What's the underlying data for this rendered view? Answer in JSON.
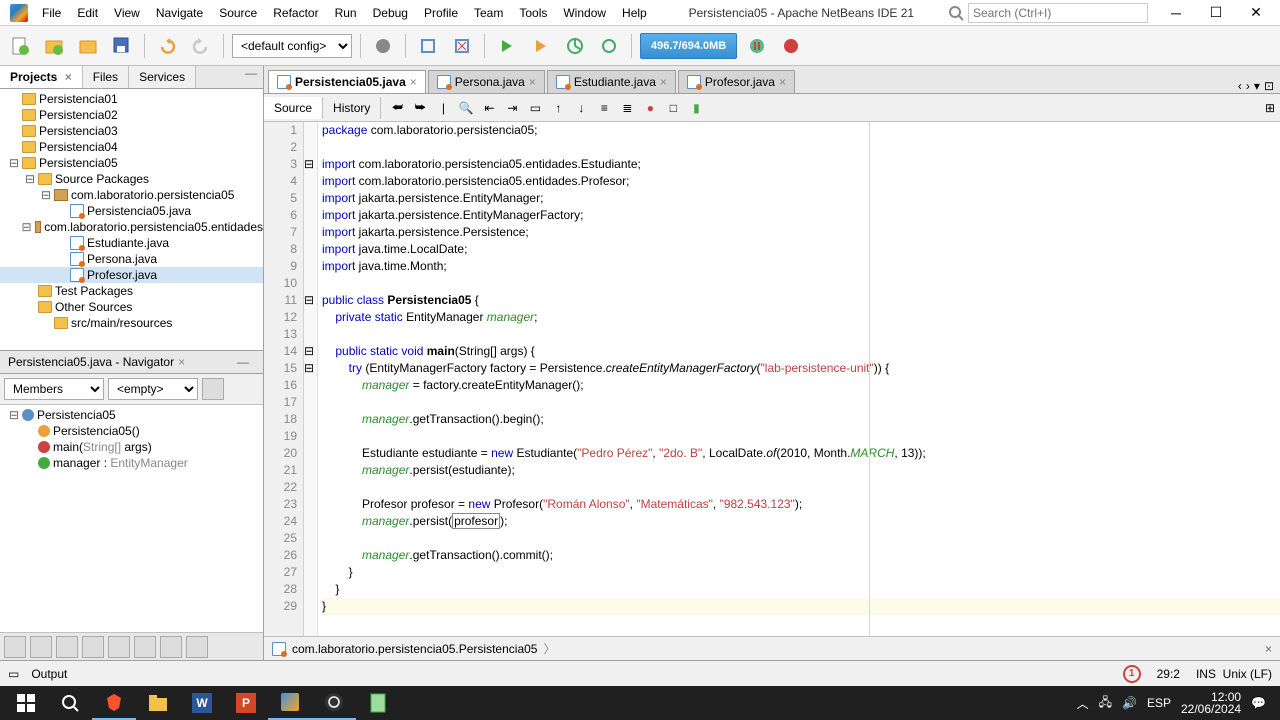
{
  "window": {
    "title": "Persistencia05 - Apache NetBeans IDE 21",
    "search_placeholder": "Search (Ctrl+I)"
  },
  "menu": [
    "File",
    "Edit",
    "View",
    "Navigate",
    "Source",
    "Refactor",
    "Run",
    "Debug",
    "Profile",
    "Team",
    "Tools",
    "Window",
    "Help"
  ],
  "toolbar": {
    "config": "<default config>",
    "memory": "496.7/694.0MB"
  },
  "projects_panel": {
    "tabs": [
      "Projects",
      "Files",
      "Services"
    ],
    "active_tab": "Projects",
    "tree": [
      {
        "level": 0,
        "icon": "folder",
        "label": "Persistencia01"
      },
      {
        "level": 0,
        "icon": "folder",
        "label": "Persistencia02"
      },
      {
        "level": 0,
        "icon": "folder",
        "label": "Persistencia03"
      },
      {
        "level": 0,
        "icon": "folder",
        "label": "Persistencia04"
      },
      {
        "level": 0,
        "icon": "folder",
        "label": "Persistencia05",
        "expanded": true
      },
      {
        "level": 1,
        "icon": "folder",
        "label": "Source Packages",
        "expanded": true
      },
      {
        "level": 2,
        "icon": "pkg",
        "label": "com.laboratorio.persistencia05",
        "expanded": true
      },
      {
        "level": 3,
        "icon": "java",
        "label": "Persistencia05.java"
      },
      {
        "level": 2,
        "icon": "pkg",
        "label": "com.laboratorio.persistencia05.entidades",
        "expanded": true
      },
      {
        "level": 3,
        "icon": "java",
        "label": "Estudiante.java"
      },
      {
        "level": 3,
        "icon": "java",
        "label": "Persona.java"
      },
      {
        "level": 3,
        "icon": "java",
        "label": "Profesor.java",
        "selected": true
      },
      {
        "level": 1,
        "icon": "folder",
        "label": "Test Packages"
      },
      {
        "level": 1,
        "icon": "folder",
        "label": "Other Sources"
      },
      {
        "level": 2,
        "icon": "folder",
        "label": "src/main/resources"
      }
    ]
  },
  "navigator": {
    "title": "Persistencia05.java - Navigator",
    "members_label": "Members",
    "empty_label": "<empty>",
    "tree": [
      {
        "level": 0,
        "icon": "class",
        "label": "Persistencia05"
      },
      {
        "level": 1,
        "icon": "ctor",
        "label": "Persistencia05()"
      },
      {
        "level": 1,
        "icon": "method",
        "label_html": "main(<span style='color:#888'>String[]</span> args)"
      },
      {
        "level": 1,
        "icon": "field",
        "label_html": "manager : <span style='color:#888'>EntityManager</span>"
      }
    ]
  },
  "editor": {
    "tabs": [
      {
        "label": "Persistencia05.java",
        "active": true
      },
      {
        "label": "Persona.java"
      },
      {
        "label": "Estudiante.java"
      },
      {
        "label": "Profesor.java"
      }
    ],
    "subtabs": [
      "Source",
      "History"
    ],
    "active_subtab": "Source",
    "breadcrumb": "com.laboratorio.persistencia05.Persistencia05",
    "code": [
      {
        "n": 1,
        "html": "<span class='kw'>package</span> com.laboratorio.persistencia05;"
      },
      {
        "n": 2,
        "html": ""
      },
      {
        "n": 3,
        "html": "<span class='kw'>import</span> com.laboratorio.persistencia05.entidades.Estudiante;"
      },
      {
        "n": 4,
        "html": "<span class='kw'>import</span> com.laboratorio.persistencia05.entidades.Profesor;"
      },
      {
        "n": 5,
        "html": "<span class='kw'>import</span> jakarta.persistence.EntityManager;"
      },
      {
        "n": 6,
        "html": "<span class='kw'>import</span> jakarta.persistence.EntityManagerFactory;"
      },
      {
        "n": 7,
        "html": "<span class='kw'>import</span> jakarta.persistence.Persistence;"
      },
      {
        "n": 8,
        "html": "<span class='kw'>import</span> java.time.LocalDate;"
      },
      {
        "n": 9,
        "html": "<span class='kw'>import</span> java.time.Month;"
      },
      {
        "n": 10,
        "html": ""
      },
      {
        "n": 11,
        "html": "<span class='kw'>public</span> <span class='kw'>class</span> <span class='cls'>Persistencia05</span> {"
      },
      {
        "n": 12,
        "html": "    <span class='kw'>private</span> <span class='kw'>static</span> EntityManager <span class='fld'>manager</span>;"
      },
      {
        "n": 13,
        "html": ""
      },
      {
        "n": 14,
        "html": "    <span class='kw'>public</span> <span class='kw'>static</span> <span class='kw'>void</span> <span class='cls'>main</span>(String[] args) {"
      },
      {
        "n": 15,
        "html": "        <span class='kw'>try</span> (EntityManagerFactory factory = Persistence.<span class='mth'>createEntityManagerFactory</span>(<span class='str'>\"lab-persistence-unit\"</span>)) {"
      },
      {
        "n": 16,
        "html": "            <span class='fld'>manager</span> = factory.createEntityManager();"
      },
      {
        "n": 17,
        "html": ""
      },
      {
        "n": 18,
        "html": "            <span class='fld'>manager</span>.getTransaction().begin();"
      },
      {
        "n": 19,
        "html": ""
      },
      {
        "n": 20,
        "html": "            Estudiante estudiante = <span class='kw'>new</span> Estudiante(<span class='str'>\"Pedro Pérez\"</span>, <span class='str'>\"2do. B\"</span>, LocalDate.<span class='mth'>of</span>(2010, Month.<span class='fld'>MARCH</span>, 13));"
      },
      {
        "n": 21,
        "html": "            <span class='fld'>manager</span>.persist(estudiante);"
      },
      {
        "n": 22,
        "html": ""
      },
      {
        "n": 23,
        "html": "            Profesor profesor = <span class='kw'>new</span> Profesor(<span class='str'>\"Román Alonso\"</span>, <span class='str'>\"Matemáticas\"</span>, <span class='str'>\"982.543.123\"</span>);"
      },
      {
        "n": 24,
        "html": "            <span class='fld'>manager</span>.persist(<span class='box'>profesor</span>);"
      },
      {
        "n": 25,
        "html": ""
      },
      {
        "n": 26,
        "html": "            <span class='fld'>manager</span>.getTransaction().commit();"
      },
      {
        "n": 27,
        "html": "        }"
      },
      {
        "n": 28,
        "html": "    }"
      },
      {
        "n": 29,
        "html": "}",
        "hl": true
      }
    ]
  },
  "status": {
    "output_label": "Output",
    "notif_count": "1",
    "cursor": "29:2",
    "mode": "INS",
    "encoding": "Unix (LF)"
  },
  "taskbar": {
    "time": "12:00",
    "date": "22/06/2024"
  }
}
